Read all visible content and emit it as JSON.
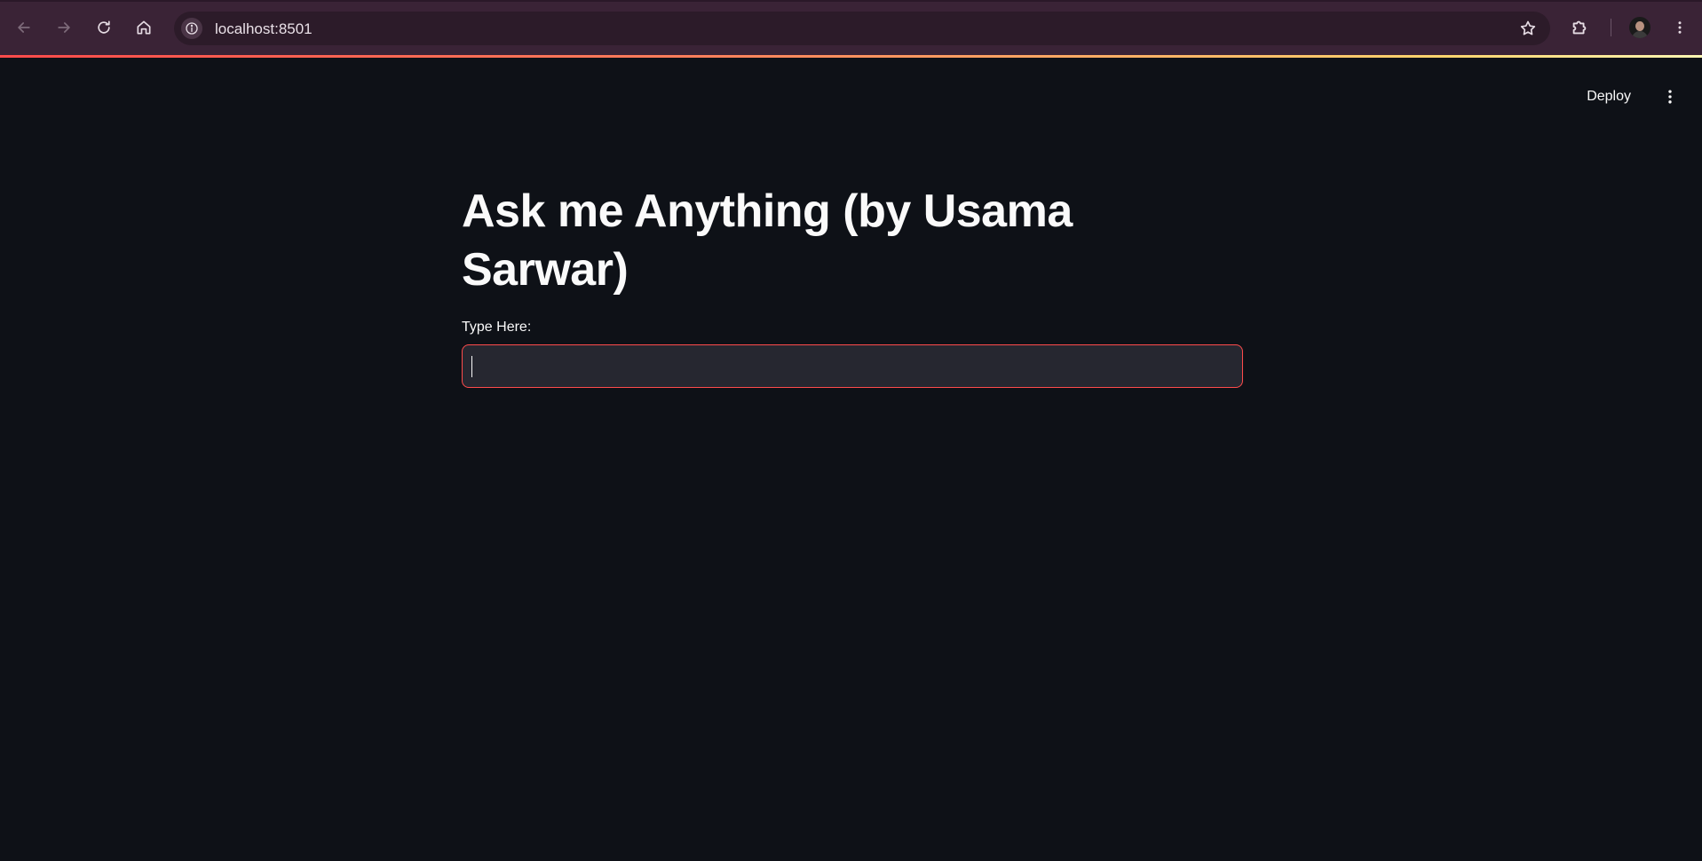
{
  "browser": {
    "url": "localhost:8501",
    "icons": {
      "back": "arrow-left-icon",
      "forward": "arrow-right-icon",
      "reload": "reload-icon",
      "home": "home-icon",
      "site_info": "info-icon",
      "bookmark": "star-icon",
      "extensions": "puzzle-icon",
      "profile": "avatar",
      "menu": "kebab-menu-icon"
    },
    "accent_gradient": [
      "#ff4b4b",
      "#ffd56e"
    ]
  },
  "app": {
    "toolbar": {
      "deploy_label": "Deploy",
      "menu_icon": "kebab-menu-icon"
    },
    "title": "Ask me Anything (by Usama Sarwar)",
    "input": {
      "label": "Type Here:",
      "value": "",
      "focused_border_color": "#ff4b4b"
    },
    "colors": {
      "background": "#0e1117",
      "input_background": "#262730",
      "text": "#fafafa"
    }
  }
}
